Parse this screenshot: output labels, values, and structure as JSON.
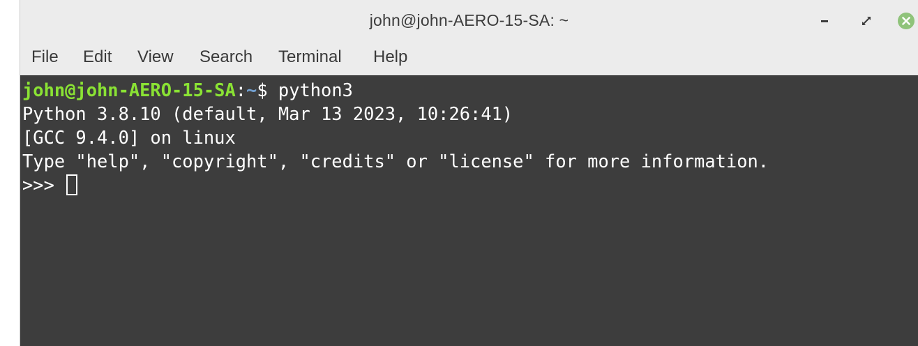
{
  "window": {
    "title": "john@john-AERO-15-SA: ~"
  },
  "menu": {
    "items": [
      "File",
      "Edit",
      "View",
      "Search",
      "Terminal",
      "Help"
    ]
  },
  "terminal": {
    "prompt_user_host": "john@john-AERO-15-SA",
    "prompt_colon": ":",
    "prompt_path": "~",
    "prompt_symbol": "$ ",
    "command": "python3",
    "output_lines": [
      "Python 3.8.10 (default, Mar 13 2023, 10:26:41)",
      "[GCC 9.4.0] on linux",
      "Type \"help\", \"copyright\", \"credits\" or \"license\" for more information."
    ],
    "repl_prompt": ">>> "
  },
  "colors": {
    "terminal_bg": "#3d3d3d",
    "prompt_user": "#8ae234",
    "prompt_path": "#729fcf",
    "close_button": "#8fc37a",
    "chrome_bg": "#ececec"
  },
  "icons": {
    "minimize": "minimize-icon",
    "maximize": "maximize-icon",
    "close": "close-icon"
  }
}
